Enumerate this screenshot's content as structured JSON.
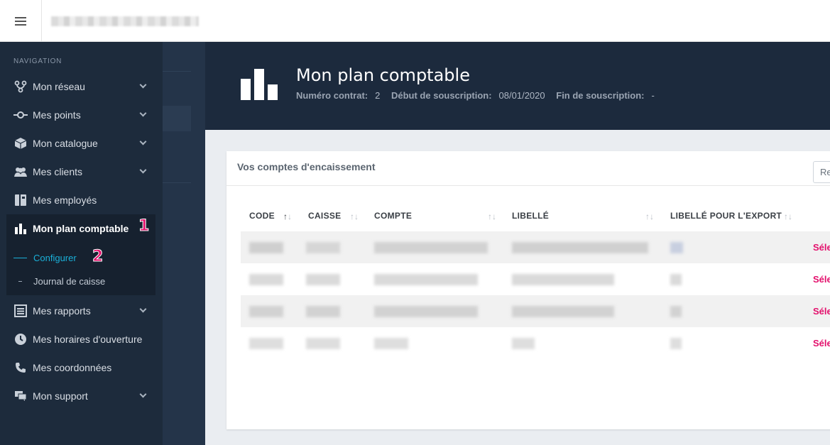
{
  "topbar": {
    "menu_icon": "hamburger-icon"
  },
  "sidebar": {
    "heading": "NAVIGATION",
    "items": [
      {
        "label": "Mon réseau",
        "icon": "network-icon",
        "chevron": true
      },
      {
        "label": "Mes points",
        "icon": "point-icon",
        "chevron": true
      },
      {
        "label": "Mon catalogue",
        "icon": "box-icon",
        "chevron": true
      },
      {
        "label": "Mes clients",
        "icon": "users-icon",
        "chevron": true
      },
      {
        "label": "Mes employés",
        "icon": "id-card-icon",
        "chevron": false
      },
      {
        "label": "Mon plan comptable",
        "icon": "bar-chart-icon",
        "chevron": false,
        "active": true
      },
      {
        "label": "Mes rapports",
        "icon": "list-icon",
        "chevron": true
      },
      {
        "label": "Mes horaires d'ouverture",
        "icon": "clock-icon",
        "chevron": false
      },
      {
        "label": "Mes coordonnées",
        "icon": "phone-icon",
        "chevron": false
      },
      {
        "label": "Mon support",
        "icon": "chat-icon",
        "chevron": true
      }
    ],
    "sub_items": [
      {
        "label": "Configurer",
        "active": true
      },
      {
        "label": "Journal de caisse",
        "active": false
      }
    ],
    "annotations": [
      "1",
      "2"
    ]
  },
  "header": {
    "title": "Mon plan comptable",
    "contract_label": "Numéro contrat:",
    "contract_value": "2",
    "start_label": "Début de souscription:",
    "start_value": "08/01/2020",
    "end_label": "Fin de souscription:",
    "end_value": "-"
  },
  "card": {
    "title": "Vos comptes d'encaissement",
    "search_partial": "Re",
    "columns": [
      "CODE",
      "CAISSE",
      "COMPTE",
      "LIBELLÉ",
      "LIBELLÉ POUR L'EXPORT"
    ],
    "row_action": "Sélec",
    "rows": 4
  },
  "colors": {
    "accent": "#e3106c",
    "sidebar": "#1d2b3c",
    "link": "#1ab0d8"
  }
}
